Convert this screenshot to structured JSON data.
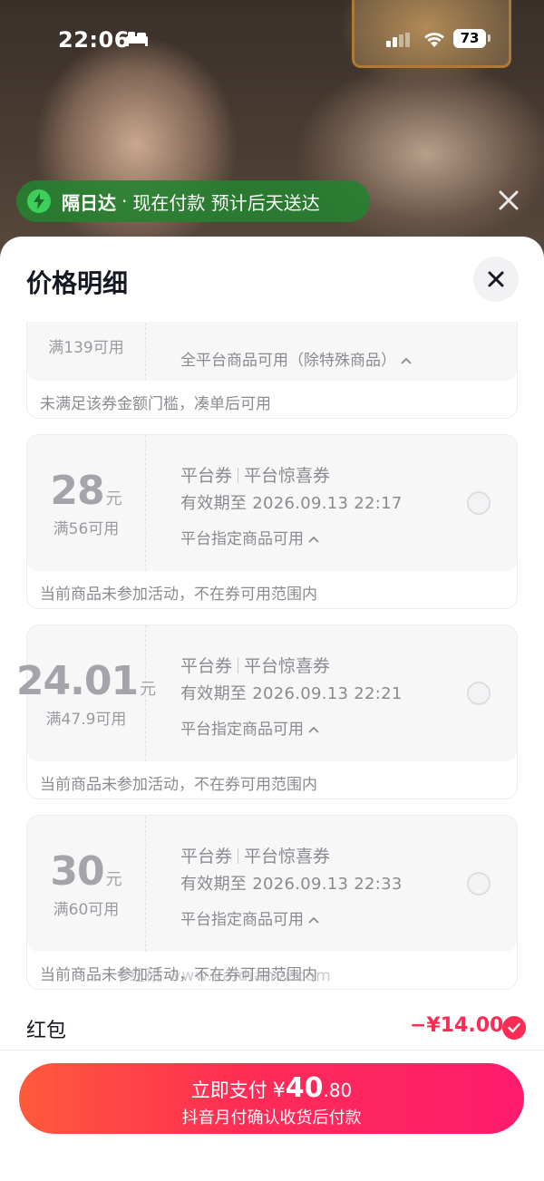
{
  "status_bar": {
    "time": "22:06",
    "battery": "73"
  },
  "banner": {
    "title": "隔日达",
    "separator": "·",
    "text": "现在付款 预计后天送达"
  },
  "sheet": {
    "title": "价格明细"
  },
  "coupons": [
    {
      "amount_int": "",
      "amount_unit": "",
      "condition": "满139可用",
      "type": "",
      "subtype": "",
      "validity": "",
      "scope": "全平台商品可用（除特殊商品）",
      "note": "未满足该券金额门槛，凑单后可用"
    },
    {
      "amount_int": "28",
      "amount_unit": "元",
      "condition": "满56可用",
      "type": "平台券",
      "subtype": "平台惊喜券",
      "validity": "有效期至 2026.09.13 22:17",
      "scope": "平台指定商品可用",
      "note": "当前商品未参加活动，不在券可用范围内"
    },
    {
      "amount_int": "24.01",
      "amount_unit": "元",
      "condition": "满47.9可用",
      "type": "平台券",
      "subtype": "平台惊喜券",
      "validity": "有效期至 2026.09.13 22:21",
      "scope": "平台指定商品可用",
      "note": "当前商品未参加活动，不在券可用范围内"
    },
    {
      "amount_int": "30",
      "amount_unit": "元",
      "condition": "满60可用",
      "type": "平台券",
      "subtype": "平台惊喜券",
      "validity": "有效期至 2026.09.13 22:33",
      "scope": "平台指定商品可用",
      "note": "当前商品未参加活动，不在券可用范围内"
    }
  ],
  "watermark": "卡纽研 www.kaidianvi.com",
  "hongbao": {
    "label": "红包",
    "amount": "−¥14.00"
  },
  "pay": {
    "label": "立即支付",
    "currency": "¥",
    "amount_int": "40",
    "amount_dec": ".80",
    "subtitle": "抖音月付确认收货后付款"
  },
  "colors": {
    "accent": "#fe2c55",
    "banner_green": "#248230",
    "muted_text": "#8a8b90"
  }
}
